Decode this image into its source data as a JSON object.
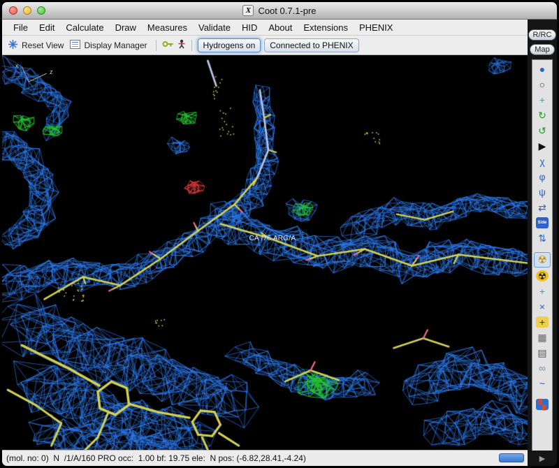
{
  "window": {
    "title": "Coot 0.7.1-pre",
    "logo_glyph": "X"
  },
  "menubar": {
    "items": [
      "File",
      "Edit",
      "Calculate",
      "Draw",
      "Measures",
      "Validate",
      "HID",
      "About",
      "Extensions",
      "PHENIX"
    ]
  },
  "toolbar": {
    "reset_view": "Reset View",
    "display_manager": "Display Manager",
    "hydrogens_btn": "Hydrogens on",
    "phenix_btn": "Connected to PHENIX"
  },
  "right_panel": {
    "rrc_btn": "R/RC",
    "map_btn": "Map",
    "overflow_arrow": "▶"
  },
  "viewport": {
    "residue_label": "CA /76 ARG/A",
    "axis_labels": {
      "x": "x",
      "z": "z"
    },
    "colors": {
      "density_2fofc": "#2e7df2",
      "diff_positive": "#25c52f",
      "diff_negative": "#e23b3b",
      "carbon_sticks": "#d2d258",
      "nitrogen_sticks": "#b7c6e8",
      "tips": "#f0699a",
      "background": "#000000"
    }
  },
  "sidebar": {
    "icons": [
      {
        "name": "view-sphere-icon",
        "glyph": "●",
        "fg": "#2e62c8"
      },
      {
        "name": "clock-icon",
        "glyph": "○",
        "fg": "#444444"
      },
      {
        "name": "translate-view-icon",
        "glyph": "+",
        "fg": "#18b2c8"
      },
      {
        "name": "refine-icon",
        "glyph": "↻",
        "fg": "#1d9a1d"
      },
      {
        "name": "regularize-icon",
        "glyph": "↺",
        "fg": "#1d9a1d"
      },
      {
        "name": "play-icon",
        "glyph": "▶",
        "fg": "#111111"
      },
      {
        "name": "rotamer-icon",
        "glyph": "χ",
        "fg": "#2e62c8"
      },
      {
        "name": "chi-angles-icon",
        "glyph": "φ",
        "fg": "#2e62c8"
      },
      {
        "name": "torsion-icon",
        "glyph": "ψ",
        "fg": "#2e62c8"
      },
      {
        "name": "rotate-translate-icon",
        "glyph": "⇄",
        "fg": "#2e62c8"
      },
      {
        "name": "side-chain-icon",
        "glyph": "Side",
        "fg": "#ffffff",
        "bg": "#2e62c8",
        "small": true
      },
      {
        "name": "flip-peptide-icon",
        "glyph": "⇅",
        "fg": "#2e62c8"
      },
      {
        "name": "radiation-active-icon",
        "glyph": "☢",
        "fg": "#c49000",
        "active": true
      },
      {
        "name": "radiation-icon",
        "glyph": "☢",
        "fg": "#222222",
        "bg": "#f2c21c",
        "round": true
      },
      {
        "name": "add-atom-icon",
        "glyph": "+",
        "fg": "#18b2c8"
      },
      {
        "name": "clear-icon",
        "glyph": "×",
        "fg": "#2e62c8"
      },
      {
        "name": "add-alt-conf-icon",
        "glyph": "+",
        "fg": "#333333",
        "bg": "#f0cf4a"
      },
      {
        "name": "grid-icon",
        "glyph": "▦",
        "fg": "#666666"
      },
      {
        "name": "delete-icon",
        "glyph": "▤",
        "fg": "#555555"
      },
      {
        "name": "ligand-icon",
        "glyph": "∞",
        "fg": "#7d8da0"
      },
      {
        "name": "skeleton-icon",
        "glyph": "~",
        "fg": "#2e62c8"
      },
      {
        "name": "display-flag-icon",
        "glyph": "▚",
        "fg": "#d64a2a",
        "bg": "#2a6fd6",
        "gap": true
      }
    ]
  },
  "statusbar": {
    "text": "(mol. no: 0)  N  /1/A/160 PRO occ:  1.00 bf: 19.75 ele:  N pos: (-6.82,28.41,-4.24)"
  }
}
